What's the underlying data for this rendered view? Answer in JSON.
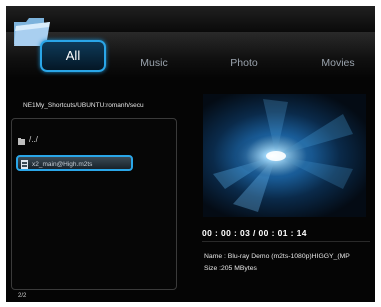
{
  "tabs": [
    {
      "label": "All",
      "active": true
    },
    {
      "label": "Music",
      "active": false
    },
    {
      "label": "Photo",
      "active": false
    },
    {
      "label": "Movies",
      "active": false
    }
  ],
  "browser": {
    "path": "NE1My_Shortcuts/UBUNTU:romanh/secu",
    "items": [
      {
        "label": "/../",
        "icon": "folder-icon"
      },
      {
        "label": "x2_main@High.m2ts",
        "icon": "video-file-icon",
        "selected": true
      }
    ],
    "pager": "2/2"
  },
  "preview": {
    "timecode": "00 : 00 : 03 / 00 : 01 : 14",
    "name_line": "Name : Blu-ray Demo (m2ts-1080p)HIGGY_(MP",
    "size_line": "Size :205 MBytes"
  },
  "colors": {
    "accent": "#2aa6e8",
    "background": "#050505"
  }
}
